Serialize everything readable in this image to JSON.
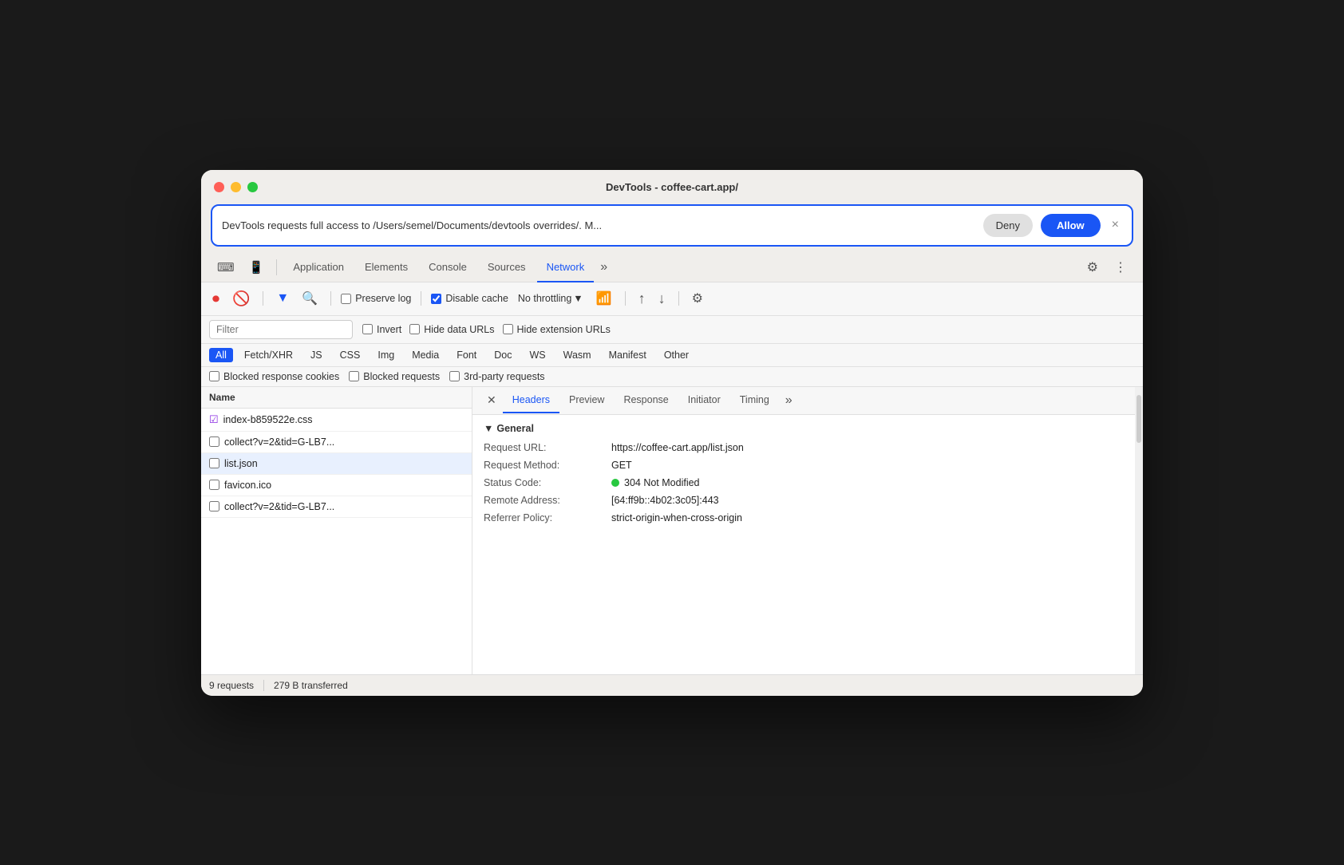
{
  "window": {
    "title": "DevTools - coffee-cart.app/"
  },
  "permission": {
    "message": "DevTools requests full access to /Users/semel/Documents/devtools overrides/. M...",
    "deny_label": "Deny",
    "allow_label": "Allow"
  },
  "tabs": {
    "items": [
      {
        "label": "Application",
        "active": false
      },
      {
        "label": "Elements",
        "active": false
      },
      {
        "label": "Console",
        "active": false
      },
      {
        "label": "Sources",
        "active": false
      },
      {
        "label": "Network",
        "active": true
      }
    ],
    "more": "»"
  },
  "network_toolbar": {
    "preserve_log": "Preserve log",
    "disable_cache": "Disable cache",
    "disable_cache_checked": true,
    "no_throttling": "No throttling"
  },
  "filter_bar": {
    "placeholder": "Filter",
    "invert_label": "Invert",
    "hide_data_urls": "Hide data URLs",
    "hide_ext_urls": "Hide extension URLs"
  },
  "type_filters": [
    "All",
    "Fetch/XHR",
    "JS",
    "CSS",
    "Img",
    "Media",
    "Font",
    "Doc",
    "WS",
    "Wasm",
    "Manifest",
    "Other"
  ],
  "active_type": "All",
  "blocked_bar": {
    "blocked_cookies": "Blocked response cookies",
    "blocked_requests": "Blocked requests",
    "third_party": "3rd-party requests"
  },
  "file_list": {
    "header": "Name",
    "items": [
      {
        "name": "index-b859522e.css",
        "icon": "☑",
        "selected": false,
        "has_icon": true
      },
      {
        "name": "collect?v=2&tid=G-LB7...",
        "icon": "☐",
        "selected": false
      },
      {
        "name": "list.json",
        "icon": "☐",
        "selected": true
      },
      {
        "name": "favicon.ico",
        "icon": "☐",
        "selected": false
      },
      {
        "name": "collect?v=2&tid=G-LB7...",
        "icon": "☐",
        "selected": false
      }
    ]
  },
  "detail_tabs": {
    "items": [
      "Headers",
      "Preview",
      "Response",
      "Initiator",
      "Timing"
    ],
    "active": "Headers",
    "more": "»"
  },
  "general": {
    "title": "General",
    "rows": [
      {
        "key": "Request URL:",
        "value": "https://coffee-cart.app/list.json"
      },
      {
        "key": "Request Method:",
        "value": "GET"
      },
      {
        "key": "Status Code:",
        "value": "304 Not Modified",
        "has_dot": true
      },
      {
        "key": "Remote Address:",
        "value": "[64:ff9b::4b02:3c05]:443"
      },
      {
        "key": "Referrer Policy:",
        "value": "strict-origin-when-cross-origin"
      }
    ]
  },
  "footer": {
    "requests": "9 requests",
    "transferred": "279 B transferred"
  }
}
